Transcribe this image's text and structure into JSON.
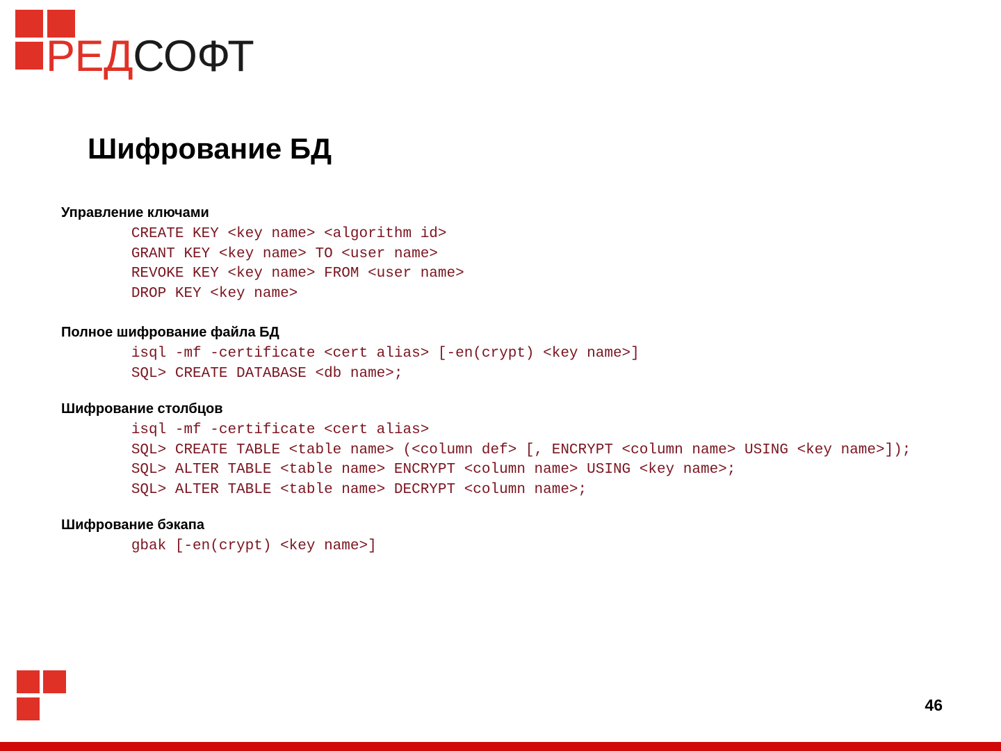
{
  "brand": {
    "logo_text_red": "РЕД",
    "logo_text_dark": "СОФТ",
    "accent_color": "#e03127",
    "bar_color": "#d00a08",
    "code_color": "#7a1520"
  },
  "slide": {
    "title": "Шифрование БД",
    "page_number": "46"
  },
  "sections": [
    {
      "heading": "Управление ключами",
      "lines": [
        "        CREATE KEY <key name> <algorithm id>",
        "        GRANT KEY <key name> TO <user name>",
        "        REVOKE KEY <key name> FROM <user name>",
        "        DROP KEY <key name>"
      ]
    },
    {
      "heading": "Полное шифрование файла БД",
      "lines": [
        "        isql -mf -certificate <cert alias> [-en(crypt) <key name>]",
        "        SQL> CREATE DATABASE <db name>;"
      ]
    },
    {
      "heading": "Шифрование столбцов",
      "lines": [
        "        isql -mf -certificate <cert alias>",
        "        SQL> CREATE TABLE <table name> (<column def> [, ENCRYPT <column name> USING <key name>]);",
        "        SQL> ALTER TABLE <table name> ENCRYPT <column name> USING <key name>;",
        "        SQL> ALTER TABLE <table name> DECRYPT <column name>;"
      ]
    },
    {
      "heading": "Шифрование бэкапа",
      "lines": [
        "        gbak [-en(crypt) <key name>]"
      ]
    }
  ]
}
